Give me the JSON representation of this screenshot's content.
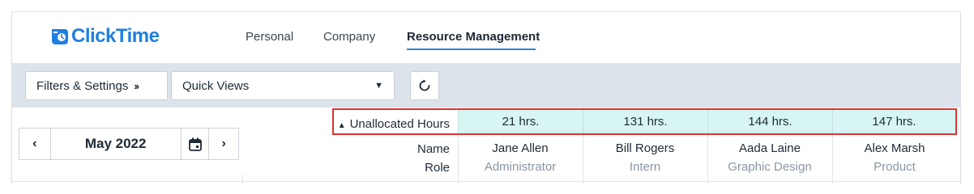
{
  "logo": {
    "text": "ClickTime",
    "brand_color": "#1f7fe0"
  },
  "nav": {
    "tabs": [
      {
        "label": "Personal",
        "active": false
      },
      {
        "label": "Company",
        "active": false
      },
      {
        "label": "Resource Management",
        "active": true
      }
    ]
  },
  "toolbar": {
    "filters_label": "Filters & Settings",
    "filters_icon": "double-chevron-right-icon",
    "quick_views_label": "Quick Views",
    "quick_views_icon": "caret-down-icon",
    "refresh_icon": "refresh-icon"
  },
  "month_picker": {
    "prev_icon": "chevron-left-icon",
    "month": "May 2022",
    "calendar_icon": "calendar-icon",
    "next_icon": "chevron-right-icon"
  },
  "grid": {
    "unallocated_label": "Unallocated Hours",
    "sort_icon": "sort-up-icon",
    "name_label": "Name",
    "role_label": "Role",
    "highlight_color": "#e03131",
    "hours_bg_color": "#d7f5f2",
    "people": [
      {
        "hours": "21 hrs.",
        "name": "Jane Allen",
        "role": "Administrator"
      },
      {
        "hours": "131 hrs.",
        "name": "Bill Rogers",
        "role": "Intern"
      },
      {
        "hours": "144 hrs.",
        "name": "Aada Laine",
        "role": "Graphic Design"
      },
      {
        "hours": "147 hrs.",
        "name": "Alex Marsh",
        "role": "Product"
      }
    ]
  }
}
